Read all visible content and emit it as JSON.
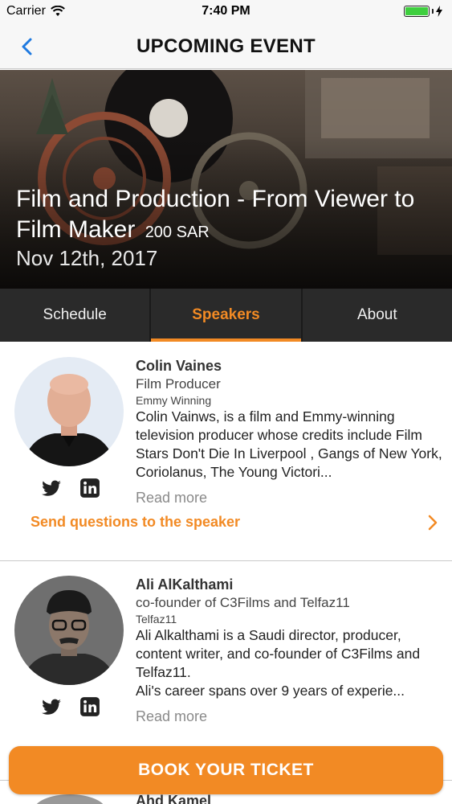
{
  "status_bar": {
    "carrier": "Carrier",
    "time": "7:40 PM"
  },
  "nav": {
    "title": "UPCOMING EVENT",
    "back_icon": "chevron-left-icon"
  },
  "event": {
    "title": "Film and Production - From Viewer to Film Maker",
    "price": "200 SAR",
    "date": "Nov 12th, 2017"
  },
  "tabs": [
    {
      "label": "Schedule",
      "active": false
    },
    {
      "label": "Speakers",
      "active": true
    },
    {
      "label": "About",
      "active": false
    }
  ],
  "speakers": [
    {
      "name": "Colin Vaines",
      "role": "Film Producer",
      "tag": "Emmy Winning",
      "bio": "Colin Vainws, is a film and Emmy-winning television producer whose credits include Film Stars Don't Die In Liverpool , Gangs of New York, Coriolanus, The Young Victori...",
      "read_more": "Read more",
      "ask_label": "Send questions to the speaker"
    },
    {
      "name": "Ali AlKalthami",
      "role": "co-founder of C3Films and Telfaz11",
      "tag": "Telfaz11",
      "bio": "Ali Alkalthami is a Saudi director, producer, content writer, and co-founder of C3Films and Telfaz11.\nAli's career spans over 9 years of experie...",
      "read_more": "Read more"
    },
    {
      "name": "Ahd Kamel"
    }
  ],
  "book_button": {
    "label": "BOOK YOUR TICKET"
  },
  "colors": {
    "accent": "#f28a24",
    "tab_bg": "#2a2a2a"
  }
}
